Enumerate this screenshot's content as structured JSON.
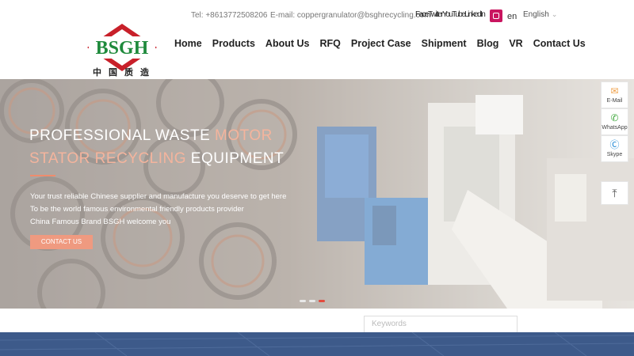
{
  "topbar": {
    "tel": "Tel: +8613772508206",
    "email": "E-mail: coppergranulator@bsghrecycling.com",
    "social_text": "FaceTwitterYouTubeLinkedIn",
    "lang_code": "en",
    "language": "English"
  },
  "logo": {
    "text": "BSGH",
    "tagline": "中国质造"
  },
  "nav": {
    "items": [
      {
        "label": "Home"
      },
      {
        "label": "Products"
      },
      {
        "label": "About Us"
      },
      {
        "label": "RFQ"
      },
      {
        "label": "Project Case"
      },
      {
        "label": "Shipment"
      },
      {
        "label": "Blog"
      },
      {
        "label": "VR"
      },
      {
        "label": "Contact Us"
      }
    ]
  },
  "banner": {
    "headline_1a": "PROFESSIONAL WASTE ",
    "headline_1b": "MOTOR",
    "headline_2a": "STATOR RECYCLING",
    "headline_2b": " EQUIPMENT",
    "line1": "Your trust reliable Chinese supplier and manufacture you deserve to get here",
    "line2": "To be the world famous environmental friendly products provider",
    "line3": "China Famous Brand BSGH welcome you",
    "button": "CONTACT US",
    "slide_count": 3,
    "active_slide": 3
  },
  "floatbar": {
    "email": "E-Mail",
    "whatsapp": "WhatsApp",
    "skype": "Skype"
  },
  "search": {
    "placeholder": "Keywords"
  },
  "colors": {
    "brand_red": "#c8202a",
    "brand_green": "#1f8a3c",
    "accent": "#e34a3d",
    "footer": "#3d5a8a"
  }
}
